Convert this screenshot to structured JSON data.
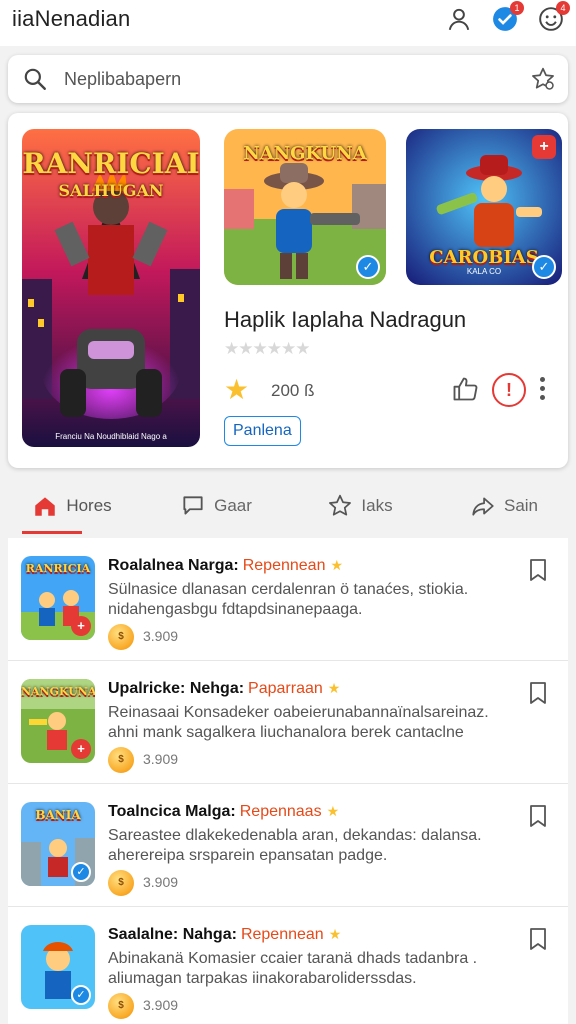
{
  "app": {
    "title": "iiaNenadian",
    "notification_badge": "1",
    "profile_badge": "4"
  },
  "search": {
    "placeholder": "Neplibabapern"
  },
  "featured": {
    "poster_title_line1": "RANRICIAI",
    "poster_title_line2": "SALHUGAN",
    "poster_caption": "Franciu Na Noudhiblaid Nago a",
    "thumb2_title": "NANGKUNA",
    "thumb3_title": "CAROBIAS",
    "thumb3_subtitle": "KALA CO",
    "name": "Haplik Iaplaha Nadragun",
    "stars_empty": "★★★★★★",
    "rating_value": "200 ß",
    "tag": "Panlena"
  },
  "tabs": [
    {
      "label": "Hores",
      "icon": "home-icon",
      "active": true
    },
    {
      "label": "Gaar",
      "icon": "chat-icon",
      "active": false
    },
    {
      "label": "Iaks",
      "icon": "star-outline-icon",
      "active": false
    },
    {
      "label": "Sain",
      "icon": "share-icon",
      "active": false
    }
  ],
  "list": [
    {
      "name": "Roalalnea Narga:",
      "tag": "Repennean",
      "desc_line1": "Sülnasice dlanasan cerdalenran ö tanaćes, stiokia.",
      "desc_line2": "nidahengasbgu fdtapdsinanepaaga.",
      "count": "3.909",
      "thumb_label": "RANRICIA",
      "corner": "plus"
    },
    {
      "name": "Upalricke: Nehga:",
      "tag": "Paparraan",
      "desc_line1": "Reinasaai Konsadeker oabeierunabannaïnalsareinaz.",
      "desc_line2": "ahni mank sagalkera liuchanalora berek cantaclne",
      "count": "3.909",
      "thumb_label": "NANGKUNA",
      "corner": "plus"
    },
    {
      "name": "Toalncica Malga:",
      "tag": "Repennaas",
      "desc_line1": "Sareastee dlakekedenabla aran, dekandas: dalansa.",
      "desc_line2": "aherereipa srsparein epansatan padge.",
      "count": "3.909",
      "thumb_label": "BANIA",
      "corner": "check"
    },
    {
      "name": "Saalalne: Nahga:",
      "tag": "Repennean",
      "desc_line1": "Abinakanä Komasier ccaier taranä dhads tadanbra .",
      "desc_line2": "aliumagan tarpakas iinakorabaroliderssdas.",
      "count": "3.909",
      "thumb_label": "",
      "corner": "check"
    }
  ],
  "colors": {
    "accent_red": "#e53935",
    "accent_blue": "#1e88e5",
    "star_yellow": "#fbc02d",
    "tag_orange": "#e64a19"
  }
}
